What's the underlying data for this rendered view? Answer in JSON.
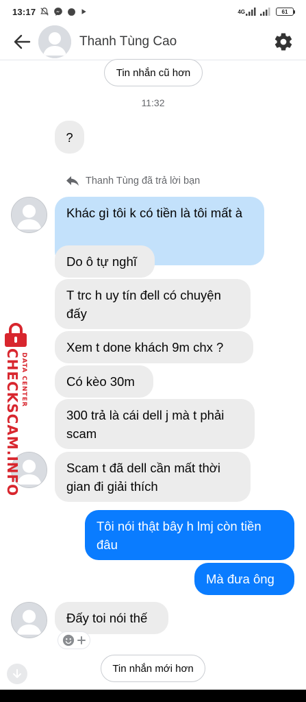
{
  "status_bar": {
    "time": "13:17",
    "network_label": "4G",
    "battery_level": "61",
    "icons": [
      "bell-off-icon",
      "messenger-icon",
      "circle-icon",
      "play-icon",
      "signal-icon",
      "battery-icon"
    ]
  },
  "header": {
    "contact_name": "Thanh Tùng Cao",
    "back_icon": "arrow-left-icon",
    "settings_icon": "gear-icon"
  },
  "older_messages_label": "Tin nhắn cũ hơn",
  "newer_messages_label": "Tin nhắn mới hơn",
  "timestamp": "11:32",
  "reply_note": "Thanh Tùng đã trả lời bạn",
  "messages": [
    {
      "text": "?",
      "sender": "contact"
    },
    {
      "text": "Khác gì tôi k có tiền là tôi mất à",
      "sender": "me",
      "style": "quoted"
    },
    {
      "text": "Do ô tự nghĩ",
      "sender": "contact"
    },
    {
      "text": "T trc h uy tín đell có chuyện đấy",
      "sender": "contact"
    },
    {
      "text": "Xem t done khách 9m chx ?",
      "sender": "contact"
    },
    {
      "text": "Có kèo 30m",
      "sender": "contact"
    },
    {
      "text": "300 trả là cái dell j mà t phải scam",
      "sender": "contact"
    },
    {
      "text": "Scam t đã dell cần mất thời gian đi giải thích",
      "sender": "contact"
    },
    {
      "text": "Tôi nói thật bây h lmj còn tiền đâu",
      "sender": "me"
    },
    {
      "text": "Mà đưa ông",
      "sender": "me"
    },
    {
      "text": "Đấy toi nói thế",
      "sender": "contact"
    }
  ],
  "reaction_chip": {
    "icons": [
      "smiley-icon",
      "plus-icon"
    ]
  },
  "watermark": {
    "main": "CHECKSCAM.INFO",
    "sub": "DATA CENTER"
  },
  "colors": {
    "sent_bubble": "#0a7cff",
    "received_bubble": "#ececec",
    "quoted_bubble": "#c3e1fb",
    "watermark": "#d8262e"
  }
}
